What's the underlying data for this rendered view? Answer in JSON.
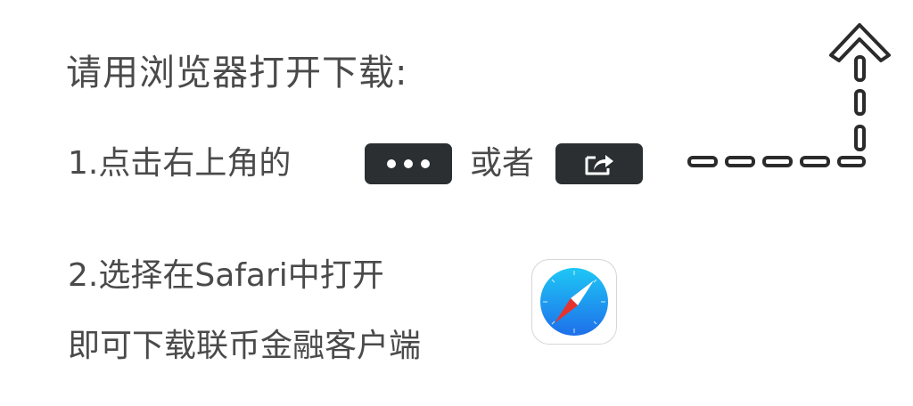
{
  "title": "请用浏览器打开下载:",
  "step1": {
    "text": "1.点击右上角的",
    "or_text": "或者",
    "more_icon": "more-dots-icon",
    "share_icon": "share-icon"
  },
  "step2": {
    "line1": "2.选择在Safari中打开",
    "line2": "即可下载联币金融客户端",
    "browser_icon": "safari-compass-icon"
  },
  "arrow_icon": "dashed-arrow-up-icon",
  "colors": {
    "text": "#4a4a4a",
    "button_bg": "#2b2f31",
    "safari_blue": "#2a86ee",
    "needle_red": "#e8322c"
  }
}
